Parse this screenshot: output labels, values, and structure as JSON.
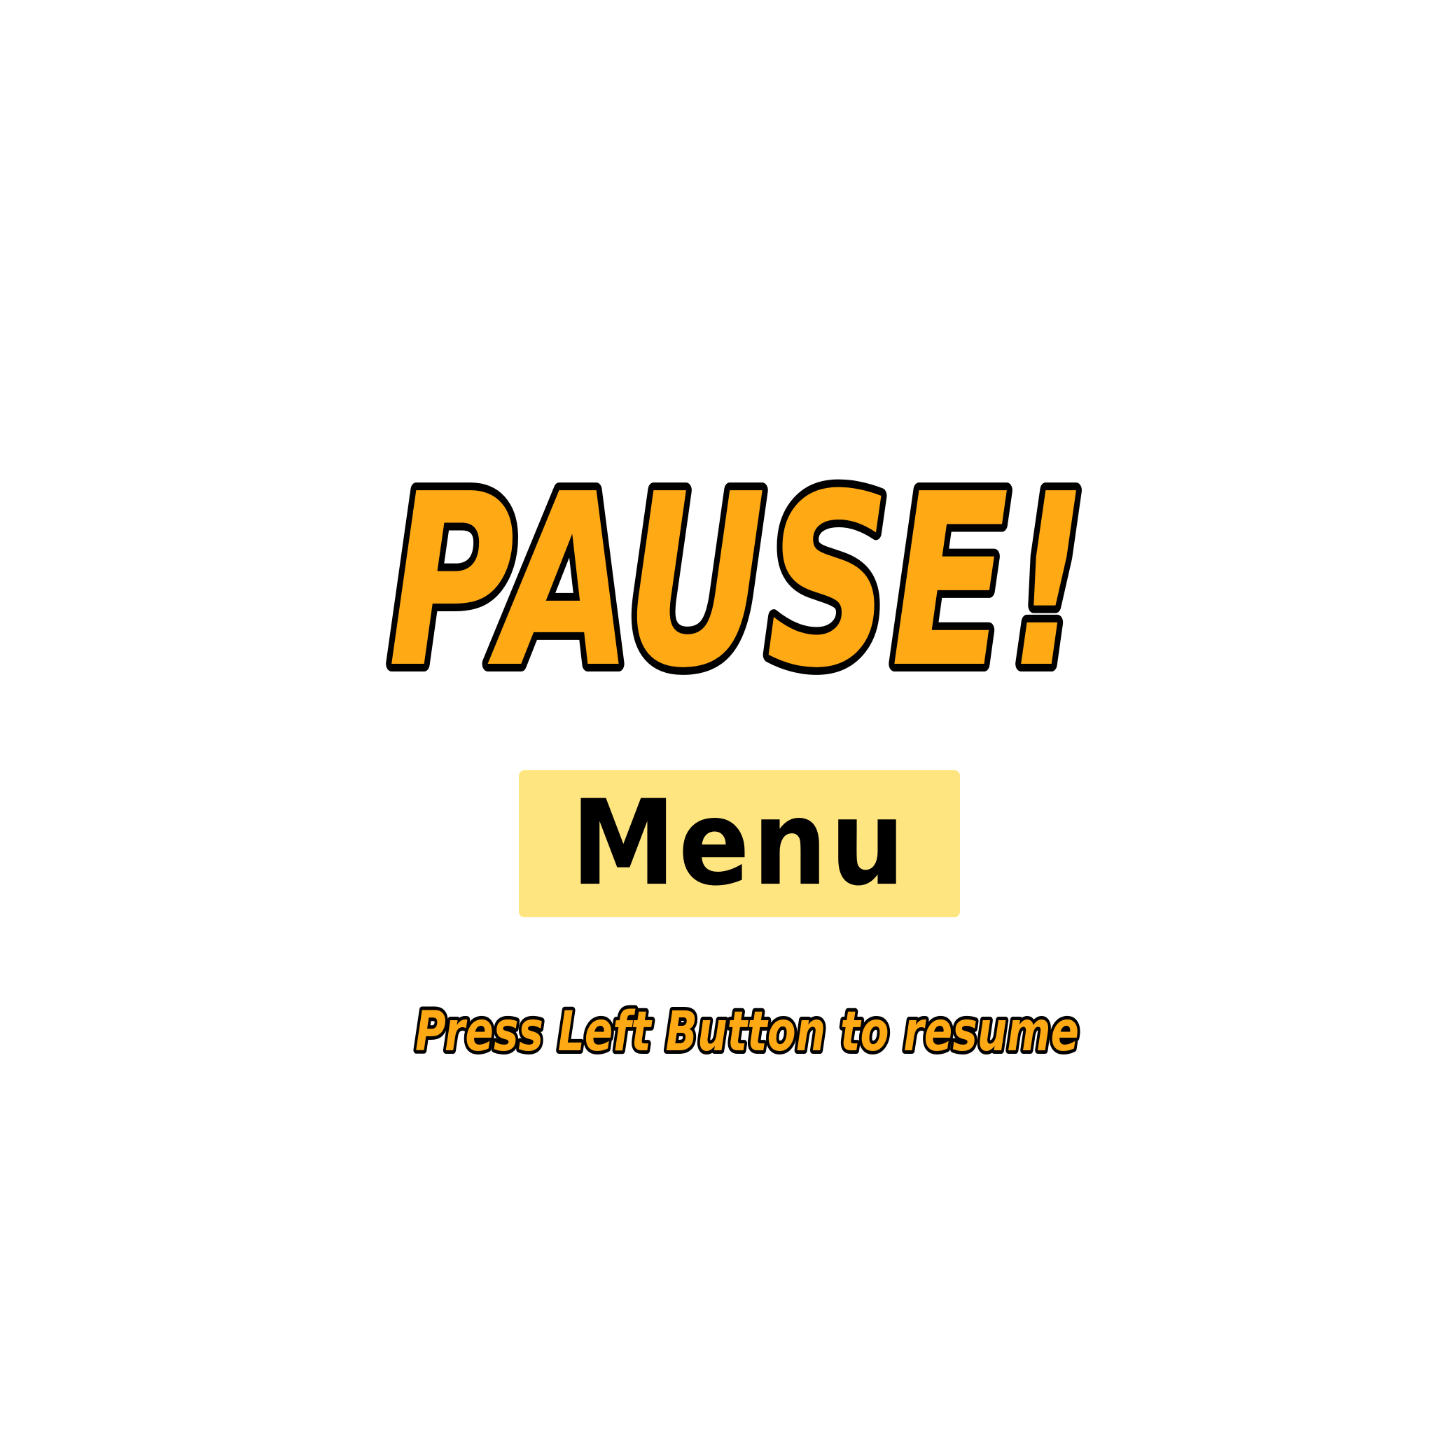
{
  "title": {
    "text": "PAUSE!",
    "fill_color": "#FFA914",
    "outline_color": "#000000"
  },
  "menu_button": {
    "label": "Menu",
    "background_color": "#FFE57F",
    "text_color": "#000000"
  },
  "hint": {
    "text": "Press Left Button to resume",
    "fill_color": "#FFA914",
    "outline_color": "#000000"
  },
  "background_color": "#FFFFFF"
}
